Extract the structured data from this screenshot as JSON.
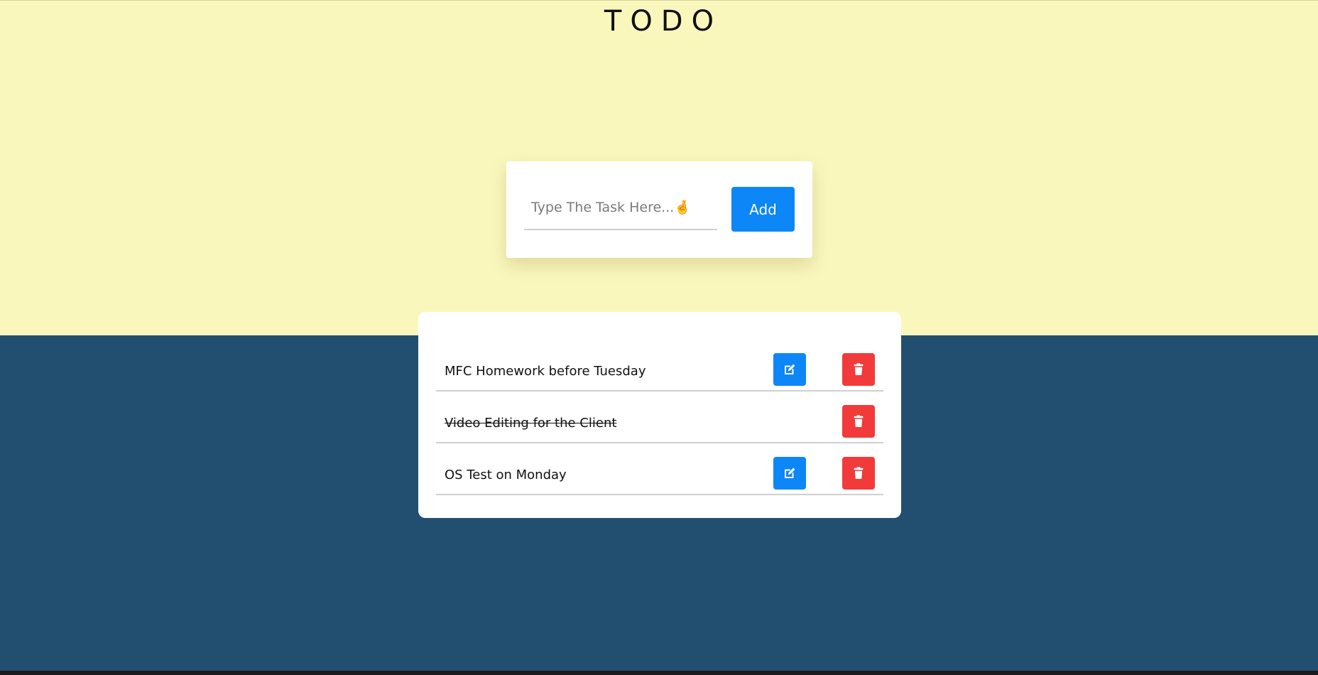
{
  "app": {
    "title": "TODO"
  },
  "input": {
    "placeholder": "Type The Task Here...🤞",
    "value": "",
    "add_label": "Add"
  },
  "tasks": [
    {
      "text": "MFC Homework before Tuesday",
      "completed": false
    },
    {
      "text": "Video Editing for the Client",
      "completed": true
    },
    {
      "text": "OS Test on Monday",
      "completed": false
    }
  ],
  "colors": {
    "top_background": "#faf7bd",
    "bottom_background": "#224f70",
    "edit_button": "#0d86f7",
    "delete_button": "#f23a3a",
    "add_button": "#0d86f7"
  },
  "icons": {
    "edit": "edit-icon",
    "delete": "trash-icon"
  }
}
